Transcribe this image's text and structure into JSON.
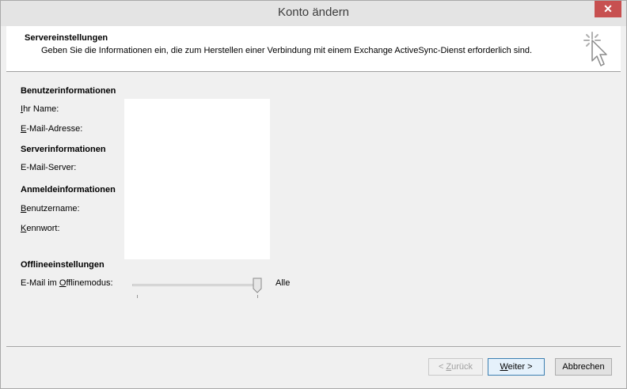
{
  "window": {
    "title": "Konto ändern",
    "close_label": "✕"
  },
  "header": {
    "title": "Servereinstellungen",
    "description": "Geben Sie die Informationen ein, die zum Herstellen einer Verbindung mit einem Exchange ActiveSync-Dienst erforderlich sind.",
    "icon": "cursor-click-icon"
  },
  "sections": {
    "user_info": "Benutzerinformationen",
    "server_info": "Serverinformationen",
    "login_info": "Anmeldeinformationen",
    "offline": "Offlineeinstellungen"
  },
  "fields": {
    "name": {
      "mnemonic": "I",
      "rest": "hr Name:"
    },
    "email": {
      "mnemonic": "E",
      "rest": "-Mail-Adresse:"
    },
    "server": {
      "label": "E-Mail-Server:"
    },
    "username": {
      "mnemonic": "B",
      "rest": "enutzername:"
    },
    "password": {
      "mnemonic": "K",
      "rest": "ennwort:"
    }
  },
  "offline_slider": {
    "label_prefix": "E-Mail im ",
    "label_mnemonic": "O",
    "label_rest": "fflinemodus:",
    "value_text": "Alle",
    "level": 1.0
  },
  "buttons": {
    "back": {
      "prefix": "< ",
      "mnemonic": "Z",
      "rest": "urück"
    },
    "next": {
      "mnemonic": "W",
      "rest": "eiter >"
    },
    "cancel": "Abbrechen"
  }
}
